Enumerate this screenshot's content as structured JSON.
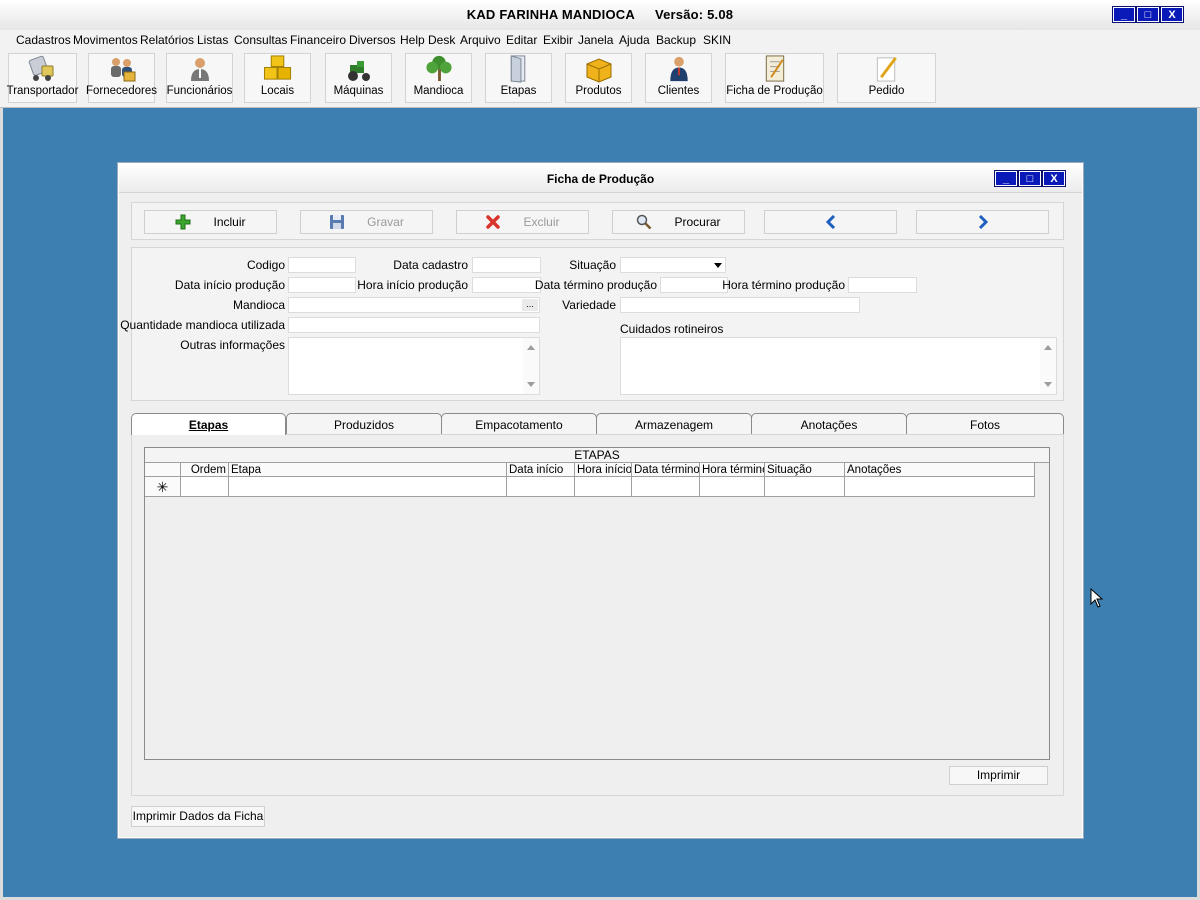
{
  "app": {
    "title": "KAD FARINHA MANDIOCA",
    "version": "Versão: 5.08",
    "window_buttons": [
      "_",
      "□",
      "X"
    ]
  },
  "menu": [
    "Cadastros",
    "Movimentos",
    "Relatórios",
    "Listas",
    "Consultas",
    "Financeiro",
    "Diversos",
    "Help Desk",
    "Arquivo",
    "Editar",
    "Exibir",
    "Janela",
    "Ajuda",
    "Backup",
    "SKIN"
  ],
  "toolbar": [
    {
      "label": "Transportador",
      "icon": "truck-icon"
    },
    {
      "label": "Fornecedores",
      "icon": "suppliers-icon"
    },
    {
      "label": "Funcionários",
      "icon": "employee-icon"
    },
    {
      "label": "Locais",
      "icon": "boxes-icon"
    },
    {
      "label": "Máquinas",
      "icon": "tractor-icon"
    },
    {
      "label": "Mandioca",
      "icon": "plant-icon"
    },
    {
      "label": "Etapas",
      "icon": "door-icon"
    },
    {
      "label": "Produtos",
      "icon": "box-icon"
    },
    {
      "label": "Clientes",
      "icon": "client-icon"
    },
    {
      "label": "Ficha de Produção",
      "icon": "notebook-icon"
    },
    {
      "label": "Pedido",
      "icon": "pencil-icon"
    }
  ],
  "form_window": {
    "title": "Ficha de Produção",
    "actions": {
      "incluir": "Incluir",
      "gravar": "Gravar",
      "excluir": "Excluir",
      "procurar": "Procurar"
    },
    "fields": {
      "codigo": {
        "label": "Codigo",
        "value": ""
      },
      "data_cadastro": {
        "label": "Data cadastro",
        "value": ""
      },
      "situacao": {
        "label": "Situação",
        "value": ""
      },
      "data_inicio": {
        "label": "Data início produção",
        "value": ""
      },
      "hora_inicio": {
        "label": "Hora início produção",
        "value": ""
      },
      "data_termino": {
        "label": "Data término produção",
        "value": ""
      },
      "hora_termino": {
        "label": "Hora término produção",
        "value": ""
      },
      "mandioca": {
        "label": "Mandioca",
        "value": "",
        "button": "..."
      },
      "variedade": {
        "label": "Variedade",
        "value": ""
      },
      "quantidade": {
        "label": "Quantidade mandioca utilizada",
        "value": ""
      },
      "outras": {
        "label": "Outras informações",
        "value": ""
      },
      "cuidados": {
        "label": "Cuidados rotineiros",
        "value": ""
      }
    },
    "tabs": [
      "Etapas",
      "Produzidos",
      "Empacotamento",
      "Armazenagem",
      "Anotações",
      "Fotos"
    ],
    "active_tab": "Etapas",
    "grid": {
      "caption": "ETAPAS",
      "columns": [
        "Ordem",
        "Etapa",
        "Data início",
        "Hora início",
        "Data término",
        "Hora término",
        "Situação",
        "Anotações"
      ],
      "new_row_marker": "✳"
    },
    "print_label": "Imprimir",
    "print_ficha_label": "Imprimir Dados da Ficha"
  }
}
